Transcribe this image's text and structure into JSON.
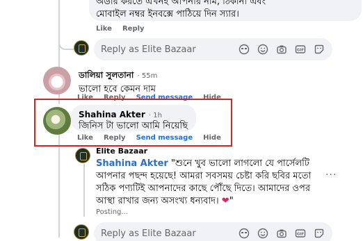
{
  "top_comment": {
    "text": "অর্ডার করতে এখনই আপনার নাম, ঠিকানা এবং\nমোবাইল নম্বর ইনবক্সে পাঠিয়ে দিন স্যার।",
    "actions": {
      "like": "Like",
      "reply": "Reply"
    }
  },
  "reply_box": {
    "placeholder": "Reply as Elite Bazaar"
  },
  "comments": [
    {
      "name": "ডালিয়া সুলতানা",
      "time": "· 55m",
      "text": "ভালো হবে কেমন দাম",
      "actions": {
        "like": "Like",
        "reply": "Reply",
        "send": "Send message",
        "hide": "Hide"
      }
    },
    {
      "name": "Shahina Akter",
      "time": "· 1h",
      "text": "জিনিস টা ভালো আমি নিয়েছি",
      "actions": {
        "like": "Like",
        "reply": "Reply",
        "send": "Send message",
        "hide": "Hide"
      }
    }
  ],
  "page_reply": {
    "name": "Elite Bazaar",
    "mention": "Shahina Akter",
    "text": " \"শুনে খুব ভালো লাগলো যে পার্সেলটি আপনার পছন্দ হয়েছে! আমরা সবসময় চেষ্টা করি ছবির মতো সঠিক পণ্যটিই আপনাদের কাছে পৌঁছে দিতে। আমাদের ওপর আস্থা রাখার জন্য অসংখ্য ধন্যবাদ।",
    "heart": "❤",
    "end": "\"",
    "status": "Posting...",
    "more": "···"
  },
  "icons": [
    "avatar-sticker-icon",
    "emoji-icon",
    "camera-icon",
    "gif-icon",
    "sticker-icon"
  ],
  "colors": {
    "link_blue": "#216fdb",
    "highlight_red": "#e02020",
    "bubble_bg": "#f0f2f5"
  }
}
